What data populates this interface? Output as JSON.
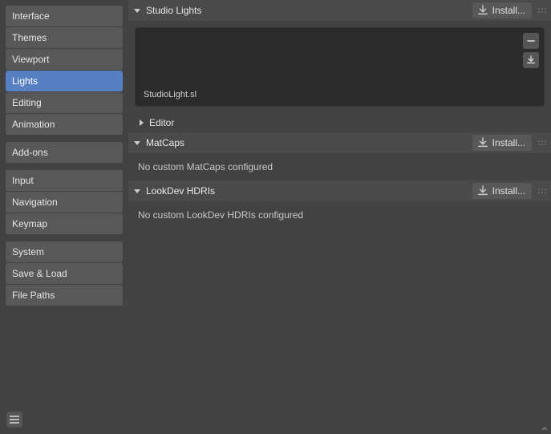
{
  "sidebar": {
    "g1": [
      {
        "label": "Interface"
      },
      {
        "label": "Themes"
      },
      {
        "label": "Viewport"
      },
      {
        "label": "Lights",
        "active": true
      },
      {
        "label": "Editing"
      },
      {
        "label": "Animation"
      }
    ],
    "g2": [
      {
        "label": "Add-ons"
      }
    ],
    "g3": [
      {
        "label": "Input"
      },
      {
        "label": "Navigation"
      },
      {
        "label": "Keymap"
      }
    ],
    "g4": [
      {
        "label": "System"
      },
      {
        "label": "Save & Load"
      },
      {
        "label": "File Paths"
      }
    ]
  },
  "panels": {
    "studio_lights": {
      "title": "Studio Lights",
      "install": "Install...",
      "preview_name": "StudioLight.sl",
      "editor_title": "Editor"
    },
    "matcaps": {
      "title": "MatCaps",
      "install": "Install...",
      "empty": "No custom MatCaps configured"
    },
    "hdris": {
      "title": "LookDev HDRIs",
      "install": "Install...",
      "empty": "No custom LookDev HDRIs configured"
    }
  }
}
